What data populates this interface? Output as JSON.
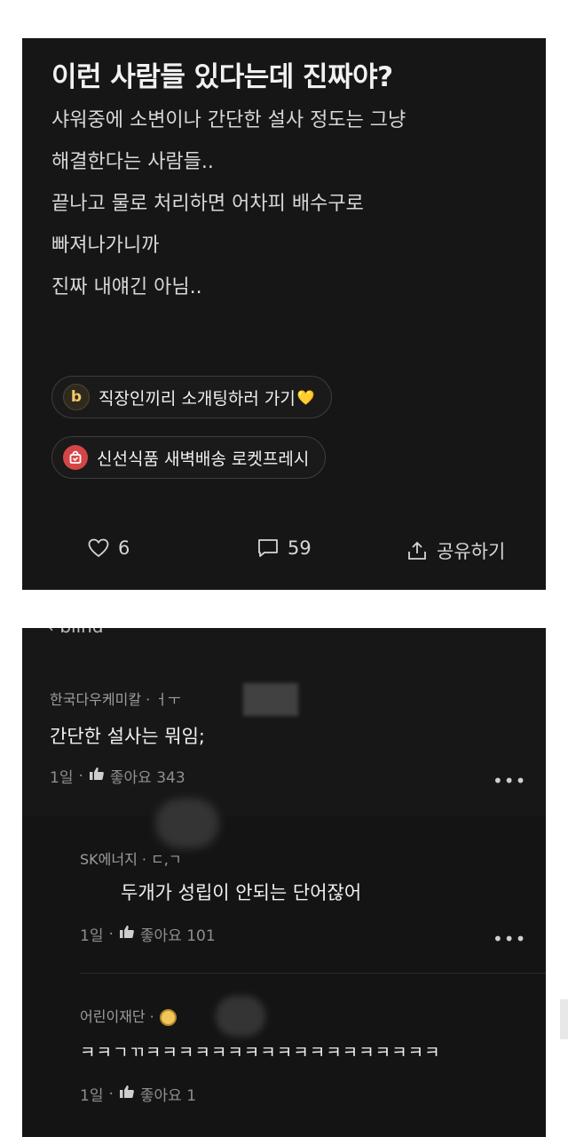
{
  "post": {
    "title": "이런 사람들 있다는데 진짜야?",
    "body_lines": [
      "샤워중에 소변이나 간단한 설사 정도는 그냥",
      "해결한다는 사람들..",
      "끝나고 물로 처리하면 어차피 배수구로",
      "빠져나가니까",
      "진짜 내얘긴 아님.."
    ],
    "ads": [
      {
        "icon": "b",
        "icon_name": "b-logo-icon",
        "label": "직장인끼리 소개팅하러 가기",
        "suffix_icon": "yellow-heart-icon"
      },
      {
        "icon": "shopping-bag-icon",
        "label": "신선식품 새벽배송 로켓프레시"
      }
    ],
    "actions": {
      "like_count": "6",
      "comment_count": "59",
      "share_label": "공유하기"
    },
    "heart_glyph": "💛"
  },
  "comments": {
    "header_fragment": "‹ blind",
    "items": [
      {
        "author": "한국다우케미칼 · ㅓㅜ",
        "text": "간단한 설사는 뭐임;",
        "age": "1일",
        "likes": "좋아요 343"
      },
      {
        "author": "SK에너지 · ㄷ,ㄱ",
        "text": "두개가 성립이 안되는 단어잖어",
        "age": "1일",
        "likes": "좋아요 101"
      },
      {
        "author": "어린이재단 ·",
        "text": "ㅋㅋㄱㄲㅋㅋㅋㅋㅋㅋㅋㅋㅋㅋㅋㅋㅋㅋㅋㅋㅋㅋ",
        "age": "1일",
        "likes": "좋아요 1"
      }
    ],
    "separator": "·",
    "more_glyph": "•••"
  },
  "colors": {
    "post_bg": "#161616",
    "comments_bg": "#141414",
    "accent_yellow": "#f1c75b",
    "accent_red": "#d54545"
  }
}
